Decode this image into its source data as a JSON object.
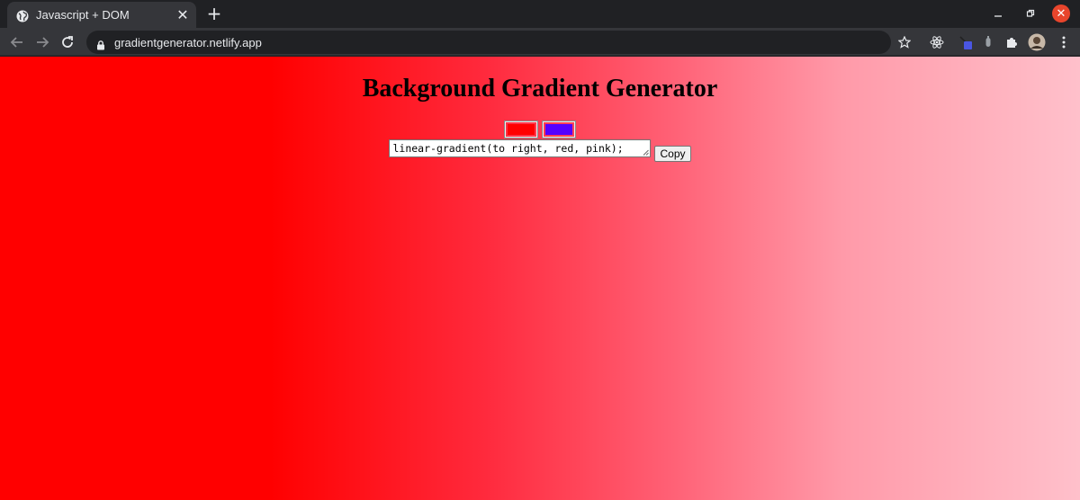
{
  "browser": {
    "tab": {
      "title": "Javascript + DOM"
    },
    "url": "gradientgenerator.netlify.app"
  },
  "page": {
    "title": "Background Gradient Generator",
    "gradient_value": "linear-gradient(to right, red, pink);",
    "copy_label": "Copy",
    "color1": "#ff0000",
    "color2": "#5500ff",
    "background_gradient": "linear-gradient(to right, red, pink)"
  },
  "icons": [
    "globe-icon",
    "close-icon",
    "plus-icon",
    "back-icon",
    "forward-icon",
    "reload-icon",
    "lock-icon",
    "star-icon",
    "react-devtools-icon",
    "extension-icon",
    "puzzle-icon",
    "avatar",
    "more-menu-icon"
  ]
}
